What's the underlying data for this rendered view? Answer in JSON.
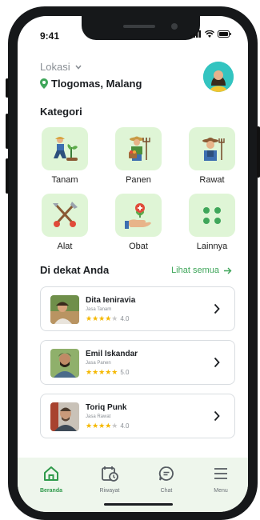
{
  "status": {
    "time": "9:41"
  },
  "location": {
    "label": "Lokasi",
    "value": "Tlogomas, Malang"
  },
  "categories": {
    "title": "Kategori",
    "items": [
      {
        "label": "Tanam",
        "icon": "planting-icon"
      },
      {
        "label": "Panen",
        "icon": "harvest-icon"
      },
      {
        "label": "Rawat",
        "icon": "farmer-icon"
      },
      {
        "label": "Alat",
        "icon": "tools-icon"
      },
      {
        "label": "Obat",
        "icon": "medicine-icon"
      },
      {
        "label": "Lainnya",
        "icon": "more-icon"
      }
    ]
  },
  "nearby": {
    "title": "Di dekat Anda",
    "see_all": "Lihat semua",
    "items": [
      {
        "name": "Dita Ieniravia",
        "role": "Jasa Tanam",
        "rating": "4.0",
        "stars": 4
      },
      {
        "name": "Emil Iskandar",
        "role": "Jasa Panen",
        "rating": "5.0",
        "stars": 5
      },
      {
        "name": "Toriq Punk",
        "role": "Jasa Rawat",
        "rating": "4.0",
        "stars": 4
      }
    ]
  },
  "nav": {
    "items": [
      {
        "label": "Beranda",
        "icon": "home-icon",
        "active": true
      },
      {
        "label": "Riwayat",
        "icon": "history-icon",
        "active": false
      },
      {
        "label": "Chat",
        "icon": "chat-icon",
        "active": false
      },
      {
        "label": "Menu",
        "icon": "menu-icon",
        "active": false
      }
    ]
  },
  "colors": {
    "accent": "#3fa65a",
    "tile": "#dff5d6",
    "star": "#f5b800",
    "nav_bg": "#eef6ec"
  }
}
